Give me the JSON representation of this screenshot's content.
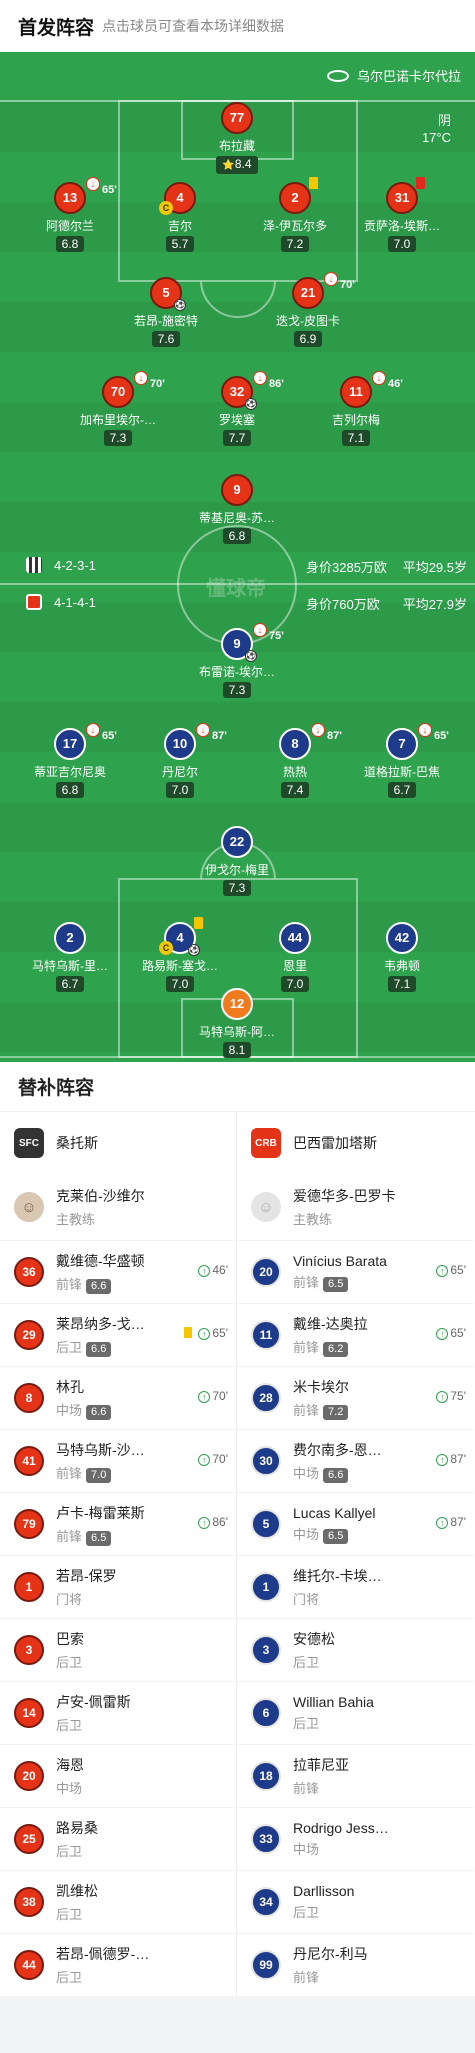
{
  "header": {
    "title": "首发阵容",
    "subtitle": "点击球员可查看本场详细数据"
  },
  "pitch": {
    "stadium": "乌尔巴诺卡尔代拉",
    "weather": "阴",
    "temperature": "17°C",
    "home_formation": "4-2-3-1",
    "home_value": "身价3285万欧",
    "home_age": "平均29.5岁",
    "away_formation": "4-1-4-1",
    "away_value": "身价760万欧",
    "away_age": "平均27.9岁",
    "watermark": "懂球帝"
  },
  "home_players": [
    {
      "num": "77",
      "name": "布拉藏",
      "rating": "8.4",
      "star": "⭐"
    },
    {
      "num": "13",
      "name": "阿德尔兰",
      "rating": "6.8",
      "sub": "65'"
    },
    {
      "num": "4",
      "name": "吉尔",
      "rating": "5.7",
      "captain": "C"
    },
    {
      "num": "2",
      "name": "泽-伊瓦尔多",
      "rating": "7.2"
    },
    {
      "num": "31",
      "name": "贡萨洛-埃斯…",
      "rating": "7.0"
    },
    {
      "num": "5",
      "name": "若昂-施密特",
      "rating": "7.6"
    },
    {
      "num": "21",
      "name": "迭戈-皮图卡",
      "rating": "6.9",
      "sub": "70'"
    },
    {
      "num": "70",
      "name": "加布里埃尔-…",
      "rating": "7.3",
      "sub": "70'"
    },
    {
      "num": "32",
      "name": "罗埃塞",
      "rating": "7.7",
      "sub": "86'"
    },
    {
      "num": "11",
      "name": "吉列尔梅",
      "rating": "7.1",
      "sub": "46'"
    },
    {
      "num": "9",
      "name": "蒂基尼奥-苏…",
      "rating": "6.8"
    }
  ],
  "away_players": [
    {
      "num": "9",
      "name": "布雷诺-埃尔…",
      "rating": "7.3",
      "sub": "75'"
    },
    {
      "num": "17",
      "name": "蒂亚吉尔尼奥",
      "rating": "6.8",
      "sub": "65'"
    },
    {
      "num": "10",
      "name": "丹尼尔",
      "rating": "7.0",
      "sub": "87'"
    },
    {
      "num": "8",
      "name": "热热",
      "rating": "7.4",
      "sub": "87'"
    },
    {
      "num": "7",
      "name": "道格拉斯-巴焦",
      "rating": "6.7",
      "sub": "65'"
    },
    {
      "num": "22",
      "name": "伊戈尔-梅里",
      "rating": "7.3"
    },
    {
      "num": "2",
      "name": "马特乌斯-里…",
      "rating": "6.7"
    },
    {
      "num": "4",
      "name": "路易斯-塞戈…",
      "rating": "7.0",
      "captain": "C"
    },
    {
      "num": "44",
      "name": "恩里",
      "rating": "7.0"
    },
    {
      "num": "42",
      "name": "韦弗顿",
      "rating": "7.1"
    },
    {
      "num": "12",
      "name": "马特乌斯-阿…",
      "rating": "8.1"
    }
  ],
  "subs": {
    "title": "替补阵容",
    "home": {
      "team": "桑托斯",
      "badge": "SFC",
      "coach": {
        "name": "克莱伯-沙维尔",
        "role": "主教练"
      },
      "players": [
        {
          "num": "36",
          "name": "戴维德-华盛顿",
          "pos": "前锋",
          "rating": "6.6",
          "min": "46'"
        },
        {
          "num": "29",
          "name": "莱昂纳多-戈…",
          "pos": "后卫",
          "rating": "6.6",
          "min": "65'",
          "yellow": true
        },
        {
          "num": "8",
          "name": "林孔",
          "pos": "中场",
          "rating": "6.6",
          "min": "70'"
        },
        {
          "num": "41",
          "name": "马特乌斯-沙…",
          "pos": "前锋",
          "rating": "7.0",
          "min": "70'"
        },
        {
          "num": "79",
          "name": "卢卡-梅雷莱斯",
          "pos": "前锋",
          "rating": "6.5",
          "min": "86'"
        },
        {
          "num": "1",
          "name": "若昂-保罗",
          "pos": "门将"
        },
        {
          "num": "3",
          "name": "巴索",
          "pos": "后卫"
        },
        {
          "num": "14",
          "name": "卢安-佩雷斯",
          "pos": "后卫"
        },
        {
          "num": "20",
          "name": "海恩",
          "pos": "中场"
        },
        {
          "num": "25",
          "name": "路易桑",
          "pos": "后卫"
        },
        {
          "num": "38",
          "name": "凯维松",
          "pos": "后卫"
        },
        {
          "num": "44",
          "name": "若昂-佩德罗-…",
          "pos": "后卫"
        }
      ]
    },
    "away": {
      "team": "巴西雷加塔斯",
      "badge": "CRB",
      "coach": {
        "name": "爱德华多-巴罗卡",
        "role": "主教练"
      },
      "players": [
        {
          "num": "20",
          "name": "Vinícius Barata",
          "pos": "前锋",
          "rating": "6.5",
          "min": "65'"
        },
        {
          "num": "11",
          "name": "戴维-达奥拉",
          "pos": "前锋",
          "rating": "6.2",
          "min": "65'"
        },
        {
          "num": "28",
          "name": "米卡埃尔",
          "pos": "前锋",
          "rating": "7.2",
          "min": "75'"
        },
        {
          "num": "30",
          "name": "费尔南多-恩…",
          "pos": "中场",
          "rating": "6.6",
          "min": "87'"
        },
        {
          "num": "5",
          "name": "Lucas Kallyel",
          "pos": "中场",
          "rating": "6.5",
          "min": "87'"
        },
        {
          "num": "1",
          "name": "维托尔-卡埃…",
          "pos": "门将"
        },
        {
          "num": "3",
          "name": "安德松",
          "pos": "后卫"
        },
        {
          "num": "6",
          "name": "Willian Bahia",
          "pos": "后卫"
        },
        {
          "num": "18",
          "name": "拉菲尼亚",
          "pos": "前锋"
        },
        {
          "num": "33",
          "name": "Rodrigo Jess…",
          "pos": "中场"
        },
        {
          "num": "34",
          "name": "Darllisson",
          "pos": "后卫"
        },
        {
          "num": "99",
          "name": "丹尼尔-利马",
          "pos": "前锋"
        }
      ]
    }
  }
}
